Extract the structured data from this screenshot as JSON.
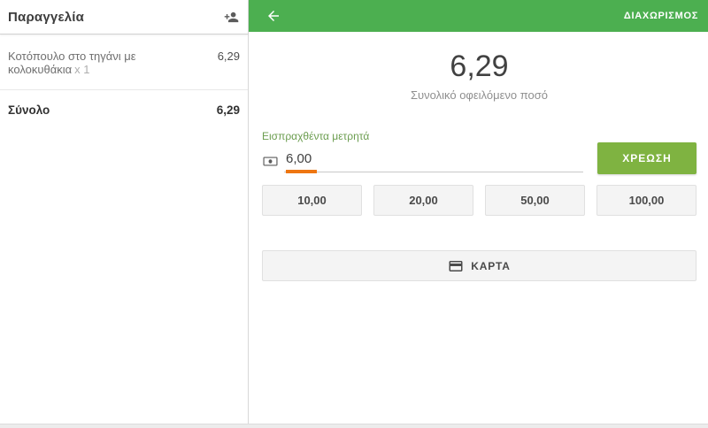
{
  "order_panel": {
    "title": "Παραγγελία",
    "add_customer_icon": "person-add-icon",
    "items": [
      {
        "name": "Κοτόπουλο στο τηγάνι με κολοκυθάκια",
        "qty": "x 1",
        "price": "6,29"
      }
    ],
    "total_label": "Σύνολο",
    "total_value": "6,29"
  },
  "payment_panel": {
    "appbar": {
      "back_icon": "arrow-back-icon",
      "action_label": "ΔΙΑΧΩΡΙΣΜΟΣ"
    },
    "amount_due": "6,29",
    "amount_due_caption": "Συνολικό οφειλόμενο ποσό",
    "cash_received": {
      "label": "Εισπραχθέντα μετρητά",
      "icon": "banknote-icon",
      "value": "6,00"
    },
    "charge_button_label": "ΧΡΕΩΣΗ",
    "quick_amounts": [
      "10,00",
      "20,00",
      "50,00",
      "100,00"
    ],
    "card_button": {
      "icon": "credit-card-icon",
      "label": "ΚΑΡΤΑ"
    }
  },
  "colors": {
    "appbar_green": "#4CAF50",
    "charge_button_green": "#7FB341",
    "cash_label_green": "#6B9D4F",
    "selection_orange": "#EE7611"
  }
}
